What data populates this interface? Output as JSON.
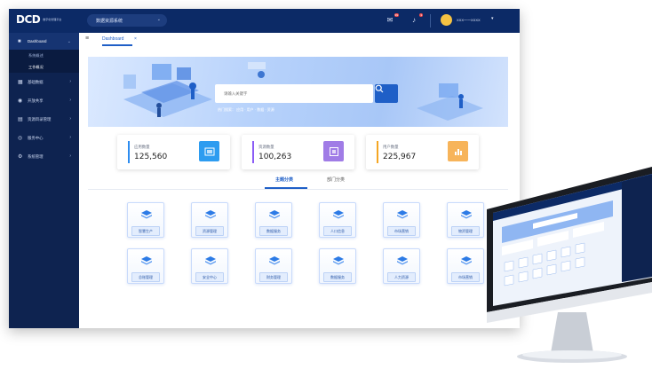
{
  "topbar": {
    "logo_text": "DCD",
    "logo_sub": "数字化管理平台",
    "system_select": "数据资源系统",
    "mail_badge": "99",
    "bell_badge": "3",
    "user_name": "XXX一一XXXX"
  },
  "sidebar": {
    "items": [
      {
        "label": "Dashboard",
        "icon": "dashboard-icon",
        "active": true
      },
      {
        "label": "系统概述",
        "sub": true
      },
      {
        "label": "工作概况",
        "sub": true,
        "active": true
      },
      {
        "label": "基础数据",
        "icon": "grid-icon"
      },
      {
        "label": "开放共享",
        "icon": "share-icon"
      },
      {
        "label": "资源目录管理",
        "icon": "catalog-icon"
      },
      {
        "label": "服务中心",
        "icon": "service-icon"
      },
      {
        "label": "系统管理",
        "icon": "settings-icon"
      }
    ]
  },
  "tabbar": {
    "tab_label": "Dashboard",
    "close": "×"
  },
  "search": {
    "placeholder": "请输入关键字",
    "hot": "热门搜索：  应用  ·  用户  ·  数据  ·  资源"
  },
  "stats": [
    {
      "label": "应用数量",
      "value": "125,560",
      "color": "#2d8cf0"
    },
    {
      "label": "资源数量",
      "value": "100,263",
      "color": "#8b5cf6"
    },
    {
      "label": "用户数量",
      "value": "225,967",
      "color": "#f5a623"
    }
  ],
  "category_tabs": [
    {
      "label": "主题分类",
      "active": true
    },
    {
      "label": "部门分类",
      "active": false
    }
  ],
  "tiles_row1": [
    "智慧生产",
    "资源管理",
    "数据服务",
    "人口信息",
    "市场营销",
    "物资管理"
  ],
  "tiles_row2": [
    "总账管理",
    "安全中心",
    "财务管理",
    "数据服务",
    "人力资源",
    "市场营销"
  ],
  "colors": {
    "topbar": "#0c2a66",
    "sidebar": "#0e2350",
    "accent": "#1f5fc7"
  }
}
